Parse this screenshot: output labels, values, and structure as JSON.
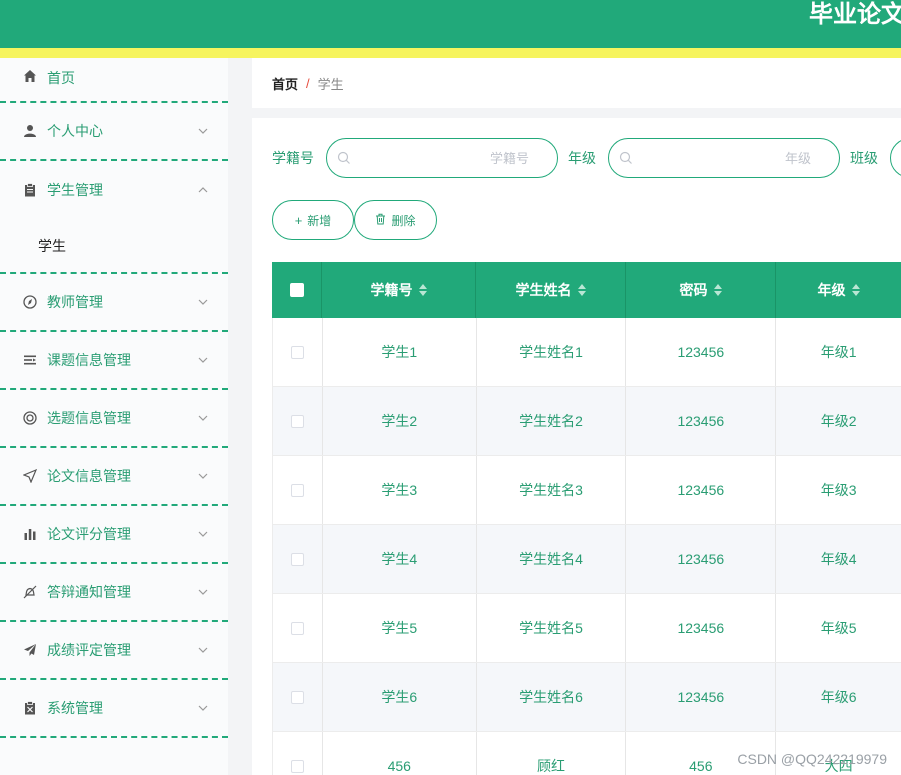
{
  "header": {
    "title": "毕业论文"
  },
  "sidebar": {
    "items": [
      {
        "label": "首页",
        "icon": "home-icon"
      },
      {
        "label": "个人中心",
        "icon": "user-icon"
      },
      {
        "label": "学生管理",
        "icon": "clipboard-icon",
        "expanded": true,
        "sub": [
          "学生"
        ]
      },
      {
        "label": "教师管理",
        "icon": "compass-icon"
      },
      {
        "label": "课题信息管理",
        "icon": "list-icon"
      },
      {
        "label": "选题信息管理",
        "icon": "lifebuoy-icon"
      },
      {
        "label": "论文信息管理",
        "icon": "send-icon"
      },
      {
        "label": "论文评分管理",
        "icon": "bar-chart-icon"
      },
      {
        "label": "答辩通知管理",
        "icon": "bell-off-icon"
      },
      {
        "label": "成绩评定管理",
        "icon": "paper-plane-icon"
      },
      {
        "label": "系统管理",
        "icon": "settings-clipboard-icon"
      }
    ]
  },
  "breadcrumb": {
    "home": "首页",
    "sep": "/",
    "current": "学生"
  },
  "search": {
    "student_id_label": "学籍号",
    "student_id_placeholder": "学籍号",
    "grade_label": "年级",
    "grade_placeholder": "年级",
    "class_label": "班级"
  },
  "buttons": {
    "add": "新增",
    "delete": "删除"
  },
  "table": {
    "columns": [
      "学籍号",
      "学生姓名",
      "密码",
      "年级"
    ],
    "rows": [
      [
        "学生1",
        "学生姓名1",
        "123456",
        "年级1"
      ],
      [
        "学生2",
        "学生姓名2",
        "123456",
        "年级2"
      ],
      [
        "学生3",
        "学生姓名3",
        "123456",
        "年级3"
      ],
      [
        "学生4",
        "学生姓名4",
        "123456",
        "年级4"
      ],
      [
        "学生5",
        "学生姓名5",
        "123456",
        "年级5"
      ],
      [
        "学生6",
        "学生姓名6",
        "123456",
        "年级6"
      ],
      [
        "456",
        "顾红",
        "456",
        "大四"
      ]
    ]
  },
  "watermark": "CSDN @QQ242219979",
  "colors": {
    "primary": "#21a97a",
    "stripe": "#f6f45e",
    "text": "#2a9d73"
  }
}
